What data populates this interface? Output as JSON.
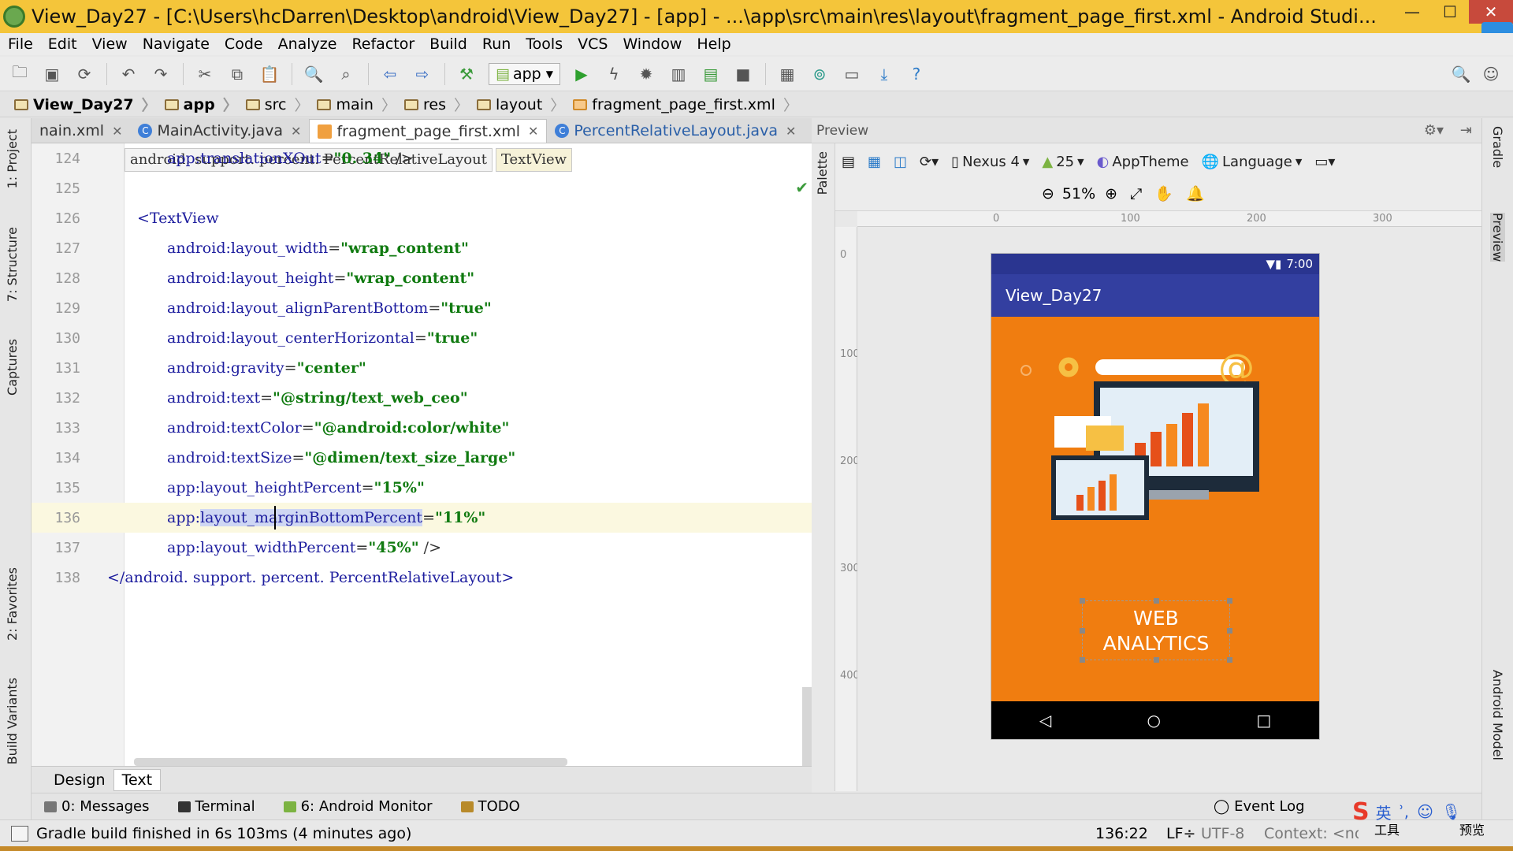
{
  "window": {
    "title": "View_Day27 - [C:\\Users\\hcDarren\\Desktop\\android\\View_Day27] - [app] - ...\\app\\src\\main\\res\\layout\\fragment_page_first.xml - Android Studi...",
    "minimize": "—",
    "maximize": "☐",
    "close": "✕"
  },
  "menu": [
    "File",
    "Edit",
    "View",
    "Navigate",
    "Code",
    "Analyze",
    "Refactor",
    "Build",
    "Run",
    "Tools",
    "VCS",
    "Window",
    "Help"
  ],
  "toolbar": {
    "run_config": "app"
  },
  "breadcrumb": [
    "View_Day27",
    "app",
    "src",
    "main",
    "res",
    "layout",
    "fragment_page_first.xml"
  ],
  "left_tools": [
    "1: Project",
    "7: Structure",
    "Captures",
    "2: Favorites",
    "Build Variants"
  ],
  "right_tools": [
    "Gradle",
    "Preview",
    "Android Model"
  ],
  "tabs": [
    {
      "label": "nain.xml",
      "active": false
    },
    {
      "label": "MainActivity.java",
      "active": false
    },
    {
      "label": "fragment_page_first.xml",
      "active": true
    },
    {
      "label": "PercentRelativeLayout.java",
      "active": false
    }
  ],
  "editor": {
    "hint_parent": "android. support. percent. PercentRelativeLayout",
    "hint_current": "TextView",
    "lines": [
      {
        "num": "124",
        "indent": "      ",
        "attr": "app:translationXOut",
        "value": "\"0. 34\"",
        "tail": " />"
      },
      {
        "num": "125",
        "indent": "",
        "attr": "",
        "value": "",
        "tail": ""
      },
      {
        "num": "126",
        "indent": "   ",
        "attr": "",
        "value": "",
        "tail": "<TextView"
      },
      {
        "num": "127",
        "indent": "      ",
        "attr": "android:layout_width",
        "value": "\"wrap_content\"",
        "tail": ""
      },
      {
        "num": "128",
        "indent": "      ",
        "attr": "android:layout_height",
        "value": "\"wrap_content\"",
        "tail": ""
      },
      {
        "num": "129",
        "indent": "      ",
        "attr": "android:layout_alignParentBottom",
        "value": "\"true\"",
        "tail": ""
      },
      {
        "num": "130",
        "indent": "      ",
        "attr": "android:layout_centerHorizontal",
        "value": "\"true\"",
        "tail": ""
      },
      {
        "num": "131",
        "indent": "      ",
        "attr": "android:gravity",
        "value": "\"center\"",
        "tail": ""
      },
      {
        "num": "132",
        "indent": "      ",
        "attr": "android:text",
        "value": "\"@string/text_web_ceo\"",
        "tail": ""
      },
      {
        "num": "133",
        "indent": "      ",
        "attr": "android:textColor",
        "value": "\"@android:color/white\"",
        "tail": ""
      },
      {
        "num": "134",
        "indent": "      ",
        "attr": "android:textSize",
        "value": "\"@dimen/text_size_large\"",
        "tail": ""
      },
      {
        "num": "135",
        "indent": "      ",
        "attr": "app:layout_heightPercent",
        "value": "\"15%\"",
        "tail": ""
      },
      {
        "num": "136",
        "indent": "      ",
        "attr": "app:layout_marginBottomPercent",
        "value": "\"11%\"",
        "tail": ""
      },
      {
        "num": "137",
        "indent": "      ",
        "attr": "app:layout_widthPercent",
        "value": "\"45%\"",
        "tail": " />"
      },
      {
        "num": "138",
        "indent": " ",
        "attr": "",
        "value": "",
        "tail": "</android. support. percent. PercentRelativeLayout>"
      }
    ]
  },
  "design_tabs": {
    "design": "Design",
    "text": "Text"
  },
  "preview": {
    "title": "Preview",
    "palette": "Palette",
    "device": "Nexus 4",
    "api": "25",
    "theme": "AppTheme",
    "language": "Language",
    "zoom": "51%",
    "ruler_top": [
      "0",
      "100",
      "200",
      "300"
    ],
    "ruler_left": [
      "0",
      "100",
      "200",
      "300",
      "400"
    ],
    "phone": {
      "time": "7:00",
      "app_title": "View_Day27",
      "web_text_line1": "WEB",
      "web_text_line2": "ANALYTICS"
    }
  },
  "tool_windows": [
    "0: Messages",
    "Terminal",
    "6: Android Monitor",
    "TODO"
  ],
  "event_log": "Event Log",
  "status": {
    "message": "Gradle build finished in 6s 103ms (4 minutes ago)",
    "position": "136:22",
    "line_sep": "LF÷",
    "encoding": "UTF-8",
    "context": "Context: <no"
  },
  "ime": {
    "lang": "英",
    "tools": "工具",
    "preview": "预览"
  },
  "colors": {
    "title_bar": "#f4c53a",
    "phone_bg": "#f07d10",
    "app_bar": "#333fa0",
    "selection": "#cfd7f3"
  }
}
